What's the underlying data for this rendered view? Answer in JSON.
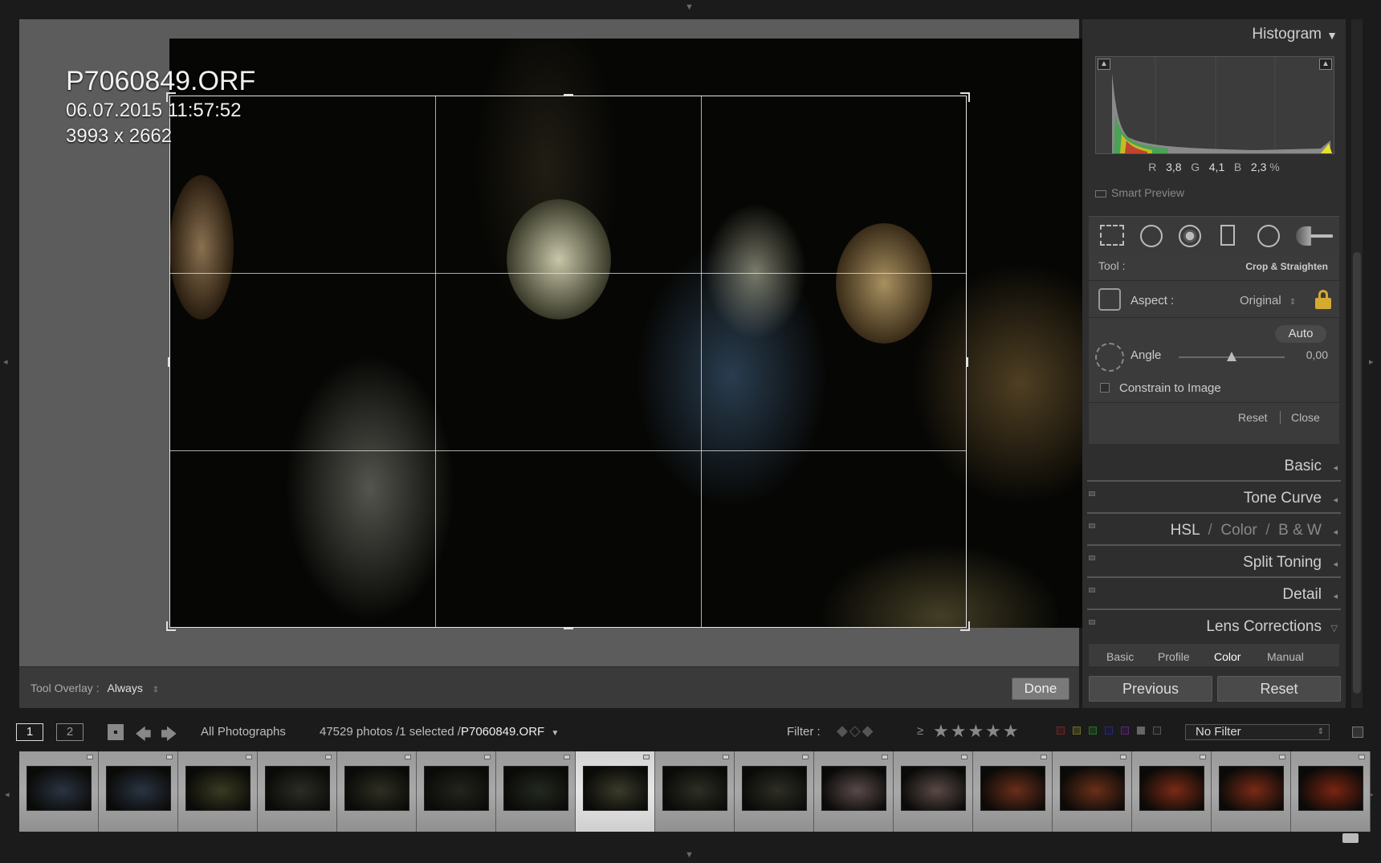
{
  "photo_info": {
    "filename": "P7060849.ORF",
    "datetime": "06.07.2015 11:57:52",
    "dimensions": "3993 x 2662"
  },
  "toolbar": {
    "tool_overlay_label": "Tool Overlay :",
    "tool_overlay_value": "Always",
    "done_label": "Done"
  },
  "right_panel": {
    "histogram": {
      "title": "Histogram",
      "r_label": "R",
      "r_value": "3,8",
      "g_label": "G",
      "g_value": "4,1",
      "b_label": "B",
      "b_value": "2,3",
      "percent": "%",
      "smart_preview": "Smart Preview"
    },
    "tools": {
      "icons": [
        "crop-icon",
        "spot-removal-icon",
        "red-eye-icon",
        "graduated-filter-icon",
        "radial-filter-icon",
        "adjustment-brush-icon"
      ],
      "tool_label": "Tool :",
      "tool_value": "Crop & Straighten",
      "aspect_label": "Aspect :",
      "aspect_value": "Original",
      "auto_label": "Auto",
      "angle_label": "Angle",
      "angle_value": "0,00",
      "angle_slider_fraction": 0.5,
      "constrain_label": "Constrain to Image",
      "constrain_checked": false,
      "reset_label": "Reset",
      "close_label": "Close"
    },
    "panels": {
      "basic": "Basic",
      "tone_curve": "Tone Curve",
      "hsl": "HSL",
      "color": "Color",
      "bw": "B & W",
      "split_toning": "Split Toning",
      "detail": "Detail",
      "lens_corrections": "Lens Corrections"
    },
    "lens_tabs": [
      "Basic",
      "Profile",
      "Color",
      "Manual"
    ],
    "lens_active_tab": "Color",
    "previous_label": "Previous",
    "reset_label": "Reset"
  },
  "filter_bar": {
    "page1": "1",
    "page2": "2",
    "source": "All Photographs",
    "count": "47529 photos /1 selected /",
    "current_file": "P7060849.ORF",
    "filter_label": "Filter :",
    "rating_op": "≥",
    "stars": "★★★★★",
    "no_filter": "No Filter"
  },
  "filmstrip": {
    "count": 17,
    "selected_index": 7,
    "thumb_colors": [
      "#2a3442",
      "#2a3442",
      "#3a3a22",
      "#2b2d24",
      "#2e2e22",
      "#23241c",
      "#23291f",
      "#3a3a2a",
      "#2d2e24",
      "#2e2e26",
      "#5a4a4a",
      "#5a4a46",
      "#6a2e1a",
      "#6a3018",
      "#7a2a16",
      "#7a2a16",
      "#7a2412"
    ]
  },
  "colors": {
    "accent": "#e0e0e0",
    "panel_bg": "#2e2e2e",
    "viewport_bg": "#5c5c5c"
  }
}
